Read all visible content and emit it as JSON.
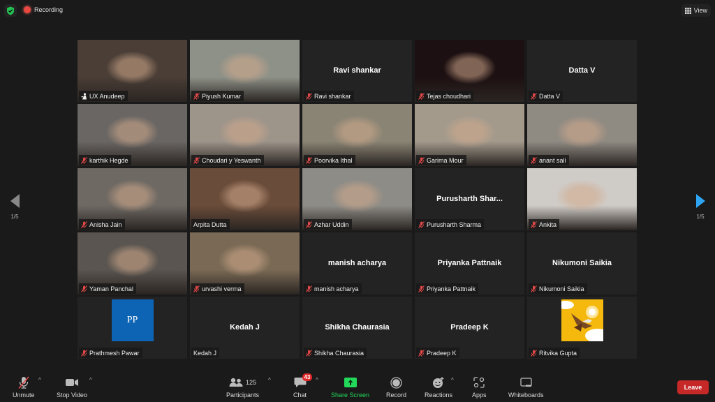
{
  "topbar": {
    "recording_label": "Recording",
    "view_label": "View"
  },
  "pagination": {
    "left": "1/5",
    "right": "1/5"
  },
  "participants": [
    {
      "name": "UX Anudeep",
      "video": true,
      "active": true,
      "pinned_icon": "host-icon",
      "muted": false,
      "bg": "#4a3e36"
    },
    {
      "name": "Piyush Kumar",
      "video": true,
      "muted": true,
      "bg": "#8e9188"
    },
    {
      "name": "Ravi shankar",
      "video": false,
      "muted": true
    },
    {
      "name": "Tejas choudhari",
      "video": true,
      "muted": true,
      "bg": "#1d1012"
    },
    {
      "name": "Datta V",
      "video": false,
      "muted": true
    },
    {
      "name": "karthik Hegde",
      "video": true,
      "muted": true,
      "bg": "#6a6663"
    },
    {
      "name": "Choudari y Yeswanth",
      "video": true,
      "muted": true,
      "bg": "#9d948a"
    },
    {
      "name": "Poorvika Ithal",
      "video": true,
      "muted": true,
      "bg": "#8a8474"
    },
    {
      "name": "Garima Mour",
      "video": true,
      "muted": true,
      "bg": "#a39a8c"
    },
    {
      "name": "anant sali",
      "video": true,
      "muted": true,
      "bg": "#8f8a82"
    },
    {
      "name": "Anisha Jain",
      "video": true,
      "muted": true,
      "bg": "#6e6963"
    },
    {
      "name": "Arpita Dutta",
      "video": true,
      "muted": false,
      "bg": "#6a4c3a"
    },
    {
      "name": "Azhar Uddin",
      "video": true,
      "muted": true,
      "bg": "#8e8c86"
    },
    {
      "name": "Purusharth Sharma",
      "display": "Purusharth  Shar...",
      "video": false,
      "muted": true
    },
    {
      "name": "Ankita",
      "video": true,
      "muted": true,
      "bg": "#cfcbc6"
    },
    {
      "name": "Yaman Panchal",
      "video": true,
      "muted": true,
      "bg": "#5a5550"
    },
    {
      "name": "urvashi verma",
      "video": true,
      "muted": true,
      "bg": "#7a6a55"
    },
    {
      "name": "manish acharya",
      "video": false,
      "muted": true
    },
    {
      "name": "Priyanka Pattnaik",
      "video": false,
      "muted": true
    },
    {
      "name": "Nikumoni Saikia",
      "video": false,
      "muted": true
    },
    {
      "name": "Prathmesh Pawar",
      "video": false,
      "muted": true,
      "avatar": "PP",
      "avatar_color": "#0e64b4"
    },
    {
      "name": "Kedah J",
      "video": false,
      "muted": false
    },
    {
      "name": "Shikha Chaurasia",
      "video": false,
      "muted": true
    },
    {
      "name": "Pradeep K",
      "video": false,
      "muted": true
    },
    {
      "name": "Ritvika Gupta",
      "video": false,
      "muted": true,
      "avatar_image": "eagle-illustration",
      "avatar_color": "#f5b80c"
    }
  ],
  "toolbar": {
    "unmute": "Unmute",
    "stop_video": "Stop Video",
    "participants": "Participants",
    "participants_count": "125",
    "chat": "Chat",
    "chat_badge": "43",
    "share_screen": "Share Screen",
    "record": "Record",
    "reactions": "Reactions",
    "apps": "Apps",
    "whiteboards": "Whiteboards",
    "leave": "Leave"
  },
  "colors": {
    "share_green": "#23d959",
    "leave_red": "#c62828",
    "active_speaker": "#c9e44a",
    "next_arrow": "#2da5f3"
  }
}
